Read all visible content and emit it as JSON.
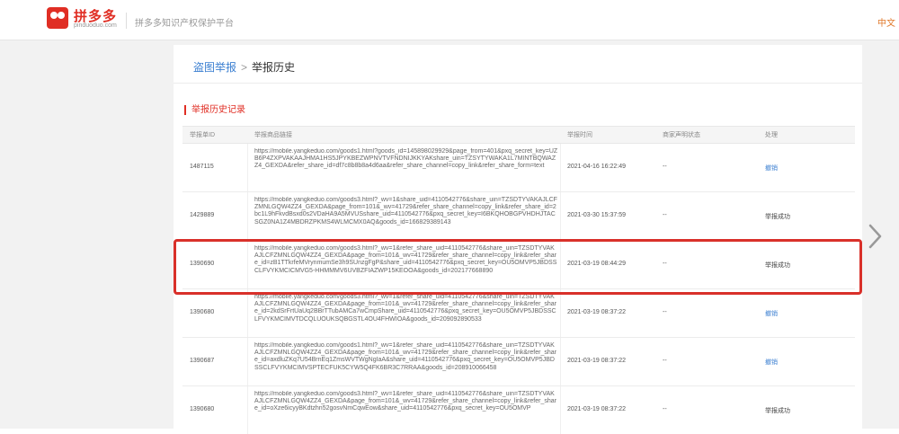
{
  "header": {
    "logo_name": "拼多多",
    "logo_domain": "pinduoduo.com",
    "platform_name": "拼多多知识产权保护平台",
    "lang": "中文"
  },
  "breadcrumb": {
    "parent": "盗图举报",
    "separator": ">",
    "current": "举报历史"
  },
  "section_title": "举报历史记录",
  "table": {
    "headers": [
      "举报单ID",
      "举报商品链接",
      "举报时间",
      "商家声明状态",
      "处理"
    ],
    "rows": [
      {
        "id": "1487115",
        "link": "https://mobile.yangkeduo.com/goods1.html?goods_id=145898029929&page_from=401&pxq_secret_key=UZB6P4ZXPVAKAAJHMA1HS5JPYKBEZWPNVTVFNDNIJKKYAKshare_uin=TZSYTYWAKA1L7MINTBQWAZZ4_GEXDA&refer_share_id=df7c8b8b8a4d6aa&refer_share_channel=copy_link&refer_share_form=text",
        "time": "2021-04-16 16:22:49",
        "status": "--",
        "action": "撤销",
        "action_success": false
      },
      {
        "id": "1429889",
        "link": "https://mobile.yangkeduo.com/goods3.html?_wv=1&share_uid=4110542776&share_uin=TZSDTYVAKAJLCFZMNLGQW4ZZ4_GEXDA&page_from=101&_wv=41729&refer_share_channel=copy_link&refer_share_id=2bc1L9hFkvdBsxd0s2VDaHA9A5MVUSshare_uid=4110542776&pxq_secret_key=I6BKQHOBGPVHDHJTACSGZ0NA1Z4MBDRZPKMS4WLMCMX0AQ&goods_id=166829389143",
        "time": "2021-03-30 15:37:59",
        "status": "--",
        "action": "举报成功",
        "action_success": true
      },
      {
        "id": "1390690",
        "link": "https://mobile.yangkeduo.com/goods3.html?_wv=1&refer_share_uid=4110542776&share_uin=TZSDTYVAKAJLCFZMNLGQW4ZZ4_GEXDA&page_from=101&_wv=41729&refer_share_channel=copy_link&refer_share_id=zB1TTkrfeMVrynmumSe3h9SUnzgFgP&share_uid=4110542776&pxq_secret_key=OU5OMVP5JBDSSCLFVYKMCICMVG5-HHMMMV6UVBZFIAZWP15KEOOA&goods_id=202177668890",
        "time": "2021-03-19 08:44:29",
        "status": "--",
        "action": "举报成功",
        "action_success": true
      },
      {
        "id": "1390680",
        "link": "https://mobile.yangkeduo.com/goods3.html?_wv=1&refer_share_uid=4110542776&share_uin=TZSDTYVAKAJLCFZMNLGQW4ZZ4_GEXDA&page_from=101&_wv=41729&refer_share_channel=copy_link&refer_share_id=2kdSrFrtUaUq2BBrTTubAMCa7wCmpShare_uid=4110542776&pxq_secret_key=OU5OMVP5JBDSSCLFVYKMCIMVTDCQLUOUKSQBGSTL4OU4FHWIOA&goods_id=209092890533",
        "time": "2021-03-19 08:37:22",
        "status": "--",
        "action": "撤销",
        "action_success": false
      },
      {
        "id": "1390687",
        "link": "https://mobile.yangkeduo.com/goods1.html?_wv=1&refer_share_uid=4110542776&share_uin=TZSDTYVAKAJLCFZMNLGQW4ZZ4_GEXDA&page_from=101&_wv=41729&refer_share_channel=copy_link&refer_share_id=axdluZKq7U54BrnEq1ZmsWVTWgNgIaA&share_uid=4110542776&pxq_secret_key=OU5OMVP5JBDSSCLFVYKMCIMVSPTECFUK5CYW5Q4FK6BR3C7RRAA&goods_id=208910066458",
        "time": "2021-03-19 08:37:22",
        "status": "--",
        "action": "撤销",
        "action_success": false
      },
      {
        "id": "1390680",
        "link": "https://mobile.yangkeduo.com/goods3.html?_wv=1&refer_share_uid=4110542776&share_uin=TZSDTYVAKAJLCFZMNLGQW4ZZ4_GEXDA&page_from=101&_wv=41729&refer_share_channel=copy_link&refer_share_id=oXze6icyyBKdtzhn52gosvNmCqwEow&share_uid=4110542776&pxq_secret_key=OU5OMVP",
        "time": "2021-03-19 08:37:22",
        "status": "--",
        "action": "举报成功",
        "action_success": true
      }
    ]
  },
  "colors": {
    "brand": "#e02e24",
    "link": "#3b7fd1",
    "highlight": "#d9302a"
  },
  "icons": {
    "next": "chevron-right-icon",
    "logo": "pinduoduo-logo-icon"
  }
}
